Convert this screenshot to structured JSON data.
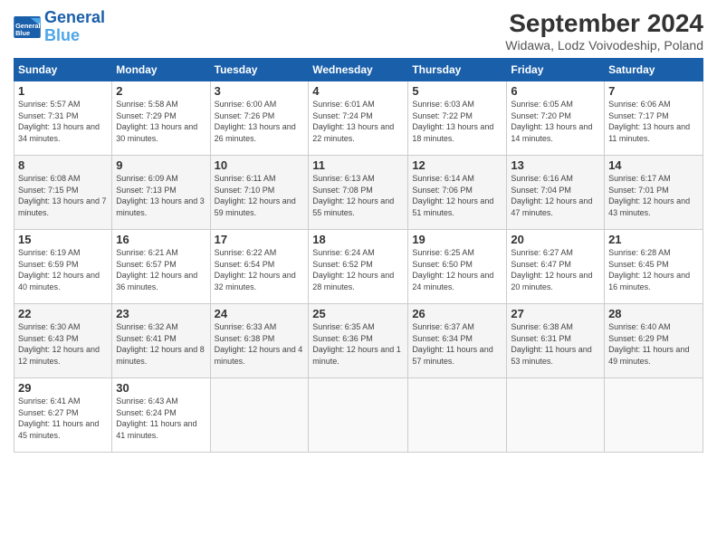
{
  "header": {
    "logo_line1": "General",
    "logo_line2": "Blue",
    "title": "September 2024",
    "subtitle": "Widawa, Lodz Voivodeship, Poland"
  },
  "calendar": {
    "days_of_week": [
      "Sunday",
      "Monday",
      "Tuesday",
      "Wednesday",
      "Thursday",
      "Friday",
      "Saturday"
    ],
    "weeks": [
      [
        null,
        {
          "day": 2,
          "sunrise": "5:58 AM",
          "sunset": "7:29 PM",
          "daylight": "13 hours and 30 minutes."
        },
        {
          "day": 3,
          "sunrise": "6:00 AM",
          "sunset": "7:26 PM",
          "daylight": "13 hours and 26 minutes."
        },
        {
          "day": 4,
          "sunrise": "6:01 AM",
          "sunset": "7:24 PM",
          "daylight": "13 hours and 22 minutes."
        },
        {
          "day": 5,
          "sunrise": "6:03 AM",
          "sunset": "7:22 PM",
          "daylight": "13 hours and 18 minutes."
        },
        {
          "day": 6,
          "sunrise": "6:05 AM",
          "sunset": "7:20 PM",
          "daylight": "13 hours and 14 minutes."
        },
        {
          "day": 7,
          "sunrise": "6:06 AM",
          "sunset": "7:17 PM",
          "daylight": "13 hours and 11 minutes."
        }
      ],
      [
        {
          "day": 1,
          "sunrise": "5:57 AM",
          "sunset": "7:31 PM",
          "daylight": "13 hours and 34 minutes."
        },
        null,
        null,
        null,
        null,
        null,
        null
      ],
      [
        {
          "day": 8,
          "sunrise": "6:08 AM",
          "sunset": "7:15 PM",
          "daylight": "13 hours and 7 minutes."
        },
        {
          "day": 9,
          "sunrise": "6:09 AM",
          "sunset": "7:13 PM",
          "daylight": "13 hours and 3 minutes."
        },
        {
          "day": 10,
          "sunrise": "6:11 AM",
          "sunset": "7:10 PM",
          "daylight": "12 hours and 59 minutes."
        },
        {
          "day": 11,
          "sunrise": "6:13 AM",
          "sunset": "7:08 PM",
          "daylight": "12 hours and 55 minutes."
        },
        {
          "day": 12,
          "sunrise": "6:14 AM",
          "sunset": "7:06 PM",
          "daylight": "12 hours and 51 minutes."
        },
        {
          "day": 13,
          "sunrise": "6:16 AM",
          "sunset": "7:04 PM",
          "daylight": "12 hours and 47 minutes."
        },
        {
          "day": 14,
          "sunrise": "6:17 AM",
          "sunset": "7:01 PM",
          "daylight": "12 hours and 43 minutes."
        }
      ],
      [
        {
          "day": 15,
          "sunrise": "6:19 AM",
          "sunset": "6:59 PM",
          "daylight": "12 hours and 40 minutes."
        },
        {
          "day": 16,
          "sunrise": "6:21 AM",
          "sunset": "6:57 PM",
          "daylight": "12 hours and 36 minutes."
        },
        {
          "day": 17,
          "sunrise": "6:22 AM",
          "sunset": "6:54 PM",
          "daylight": "12 hours and 32 minutes."
        },
        {
          "day": 18,
          "sunrise": "6:24 AM",
          "sunset": "6:52 PM",
          "daylight": "12 hours and 28 minutes."
        },
        {
          "day": 19,
          "sunrise": "6:25 AM",
          "sunset": "6:50 PM",
          "daylight": "12 hours and 24 minutes."
        },
        {
          "day": 20,
          "sunrise": "6:27 AM",
          "sunset": "6:47 PM",
          "daylight": "12 hours and 20 minutes."
        },
        {
          "day": 21,
          "sunrise": "6:28 AM",
          "sunset": "6:45 PM",
          "daylight": "12 hours and 16 minutes."
        }
      ],
      [
        {
          "day": 22,
          "sunrise": "6:30 AM",
          "sunset": "6:43 PM",
          "daylight": "12 hours and 12 minutes."
        },
        {
          "day": 23,
          "sunrise": "6:32 AM",
          "sunset": "6:41 PM",
          "daylight": "12 hours and 8 minutes."
        },
        {
          "day": 24,
          "sunrise": "6:33 AM",
          "sunset": "6:38 PM",
          "daylight": "12 hours and 4 minutes."
        },
        {
          "day": 25,
          "sunrise": "6:35 AM",
          "sunset": "6:36 PM",
          "daylight": "12 hours and 1 minute."
        },
        {
          "day": 26,
          "sunrise": "6:37 AM",
          "sunset": "6:34 PM",
          "daylight": "11 hours and 57 minutes."
        },
        {
          "day": 27,
          "sunrise": "6:38 AM",
          "sunset": "6:31 PM",
          "daylight": "11 hours and 53 minutes."
        },
        {
          "day": 28,
          "sunrise": "6:40 AM",
          "sunset": "6:29 PM",
          "daylight": "11 hours and 49 minutes."
        }
      ],
      [
        {
          "day": 29,
          "sunrise": "6:41 AM",
          "sunset": "6:27 PM",
          "daylight": "11 hours and 45 minutes."
        },
        {
          "day": 30,
          "sunrise": "6:43 AM",
          "sunset": "6:24 PM",
          "daylight": "11 hours and 41 minutes."
        },
        null,
        null,
        null,
        null,
        null
      ]
    ]
  }
}
